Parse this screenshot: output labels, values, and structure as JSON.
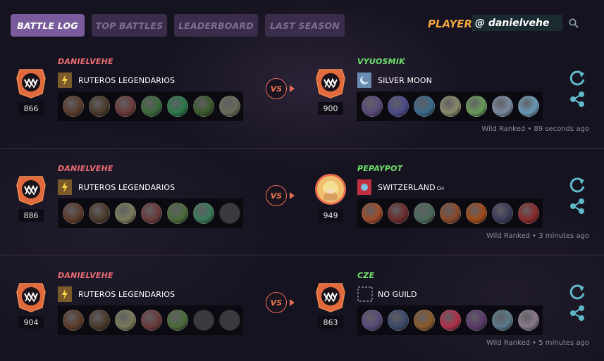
{
  "tabs": [
    {
      "label": "BATTLE LOG",
      "active": true
    },
    {
      "label": "TOP BATTLES",
      "active": false
    },
    {
      "label": "LEADERBOARD",
      "active": false
    },
    {
      "label": "LAST SEASON",
      "active": false
    }
  ],
  "player": {
    "label": "PLAYER:",
    "value": "@ danielvehe"
  },
  "colors": {
    "accent": "#7a5c9e",
    "left_name": "#e86c72",
    "right_name": "#6fe06a",
    "player_label": "#f0a540",
    "action": "#5fb8c8"
  },
  "battles": [
    {
      "left": {
        "name": "DANIELVEHE",
        "rating": "866",
        "guild": "RUTEROS LEGENDARIOS",
        "guild_suffix": "",
        "guild_icon": "lightning-banner-icon",
        "avatar": "monster-emblem-icon",
        "cards": [
          "#5a3a2a",
          "#4a3a2a",
          "#6a3a3a",
          "#3a6a3a",
          "#2a7a4a",
          "#3a5a2a",
          "#6a6a5a"
        ]
      },
      "vs": "VS",
      "right": {
        "name": "VYUOSMIK",
        "rating": "900",
        "guild": "SILVER MOON",
        "guild_suffix": "",
        "guild_icon": "moon-banner-icon",
        "avatar": "monster-emblem-icon",
        "cards": [
          "#5a4a7a",
          "#4a4a8a",
          "#3a6a8a",
          "#8a8a6a",
          "#6a9a5a",
          "#7a8aa0",
          "#6a9ab8"
        ]
      },
      "meta": "Wild Ranked • 89 seconds ago"
    },
    {
      "left": {
        "name": "DANIELVEHE",
        "rating": "886",
        "guild": "RUTEROS LEGENDARIOS",
        "guild_suffix": "",
        "guild_icon": "lightning-banner-icon",
        "avatar": "monster-emblem-icon",
        "cards": [
          "#5a3a2a",
          "#4a3a2a",
          "#7a7a5a",
          "#6a3a3a",
          "#4a6a3a",
          "#3a7a5a",
          "empty"
        ]
      },
      "vs": "VS",
      "right": {
        "name": "PEPAYPOT",
        "rating": "949",
        "guild": "SWITZERLAND",
        "guild_suffix": "CH",
        "guild_icon": "red-banner-icon",
        "avatar": "portrait-avatar-icon",
        "cards": [
          "#a04a2a",
          "#6a2a2a",
          "#4a6a5a",
          "#8a4a2a",
          "#a04a1a",
          "#3a3a5a",
          "#8a2a2a"
        ]
      },
      "meta": "Wild Ranked • 3 minutes ago"
    },
    {
      "left": {
        "name": "DANIELVEHE",
        "rating": "904",
        "guild": "RUTEROS LEGENDARIOS",
        "guild_suffix": "",
        "guild_icon": "lightning-banner-icon",
        "avatar": "monster-emblem-icon",
        "cards": [
          "#5a3a2a",
          "#4a3a2a",
          "#7a7a5a",
          "#6a3a3a",
          "#4a6a3a",
          "empty",
          "empty"
        ]
      },
      "vs": "VS",
      "right": {
        "name": "CZE",
        "rating": "863",
        "guild": "NO GUILD",
        "guild_suffix": "",
        "guild_icon": "empty-guild-icon",
        "avatar": "monster-emblem-icon",
        "cards": [
          "#5a4a7a",
          "#3a4a6a",
          "#8a5a2a",
          "#b0304a",
          "#5a3a6a",
          "#5a7a8a",
          "#8a7a8a"
        ]
      },
      "meta": "Wild Ranked • 5 minutes ago"
    }
  ]
}
